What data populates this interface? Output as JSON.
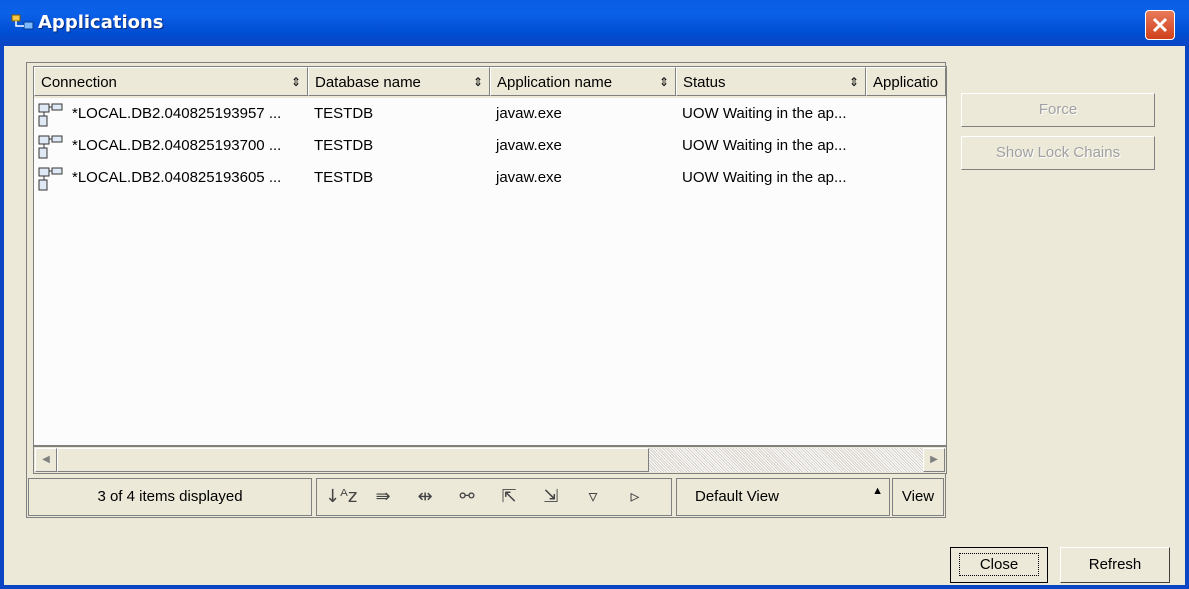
{
  "window": {
    "title": "Applications"
  },
  "table": {
    "columns": [
      "Connection",
      "Database name",
      "Application name",
      "Status",
      "Applicatio"
    ],
    "rows": [
      {
        "connection": "*LOCAL.DB2.040825193957  ...",
        "database": "TESTDB",
        "application": "javaw.exe",
        "status": "UOW Waiting in the ap..."
      },
      {
        "connection": "*LOCAL.DB2.040825193700  ...",
        "database": "TESTDB",
        "application": "javaw.exe",
        "status": "UOW Waiting in the ap..."
      },
      {
        "connection": "*LOCAL.DB2.040825193605  ...",
        "database": "TESTDB",
        "application": "javaw.exe",
        "status": "UOW Waiting in the ap..."
      }
    ]
  },
  "status_text": "3 of 4 items displayed",
  "view": {
    "selected": "Default View",
    "button": "View"
  },
  "side_buttons": {
    "force": "Force",
    "show_lock_chains": "Show Lock Chains"
  },
  "dialog_buttons": {
    "close": "Close",
    "refresh": "Refresh"
  },
  "toolbar_icons": [
    "sort-icon",
    "filter-icon",
    "customize-columns-icon",
    "find-icon",
    "select-all-icon",
    "deselect-all-icon",
    "expand-all-icon",
    "collapse-all-icon"
  ]
}
